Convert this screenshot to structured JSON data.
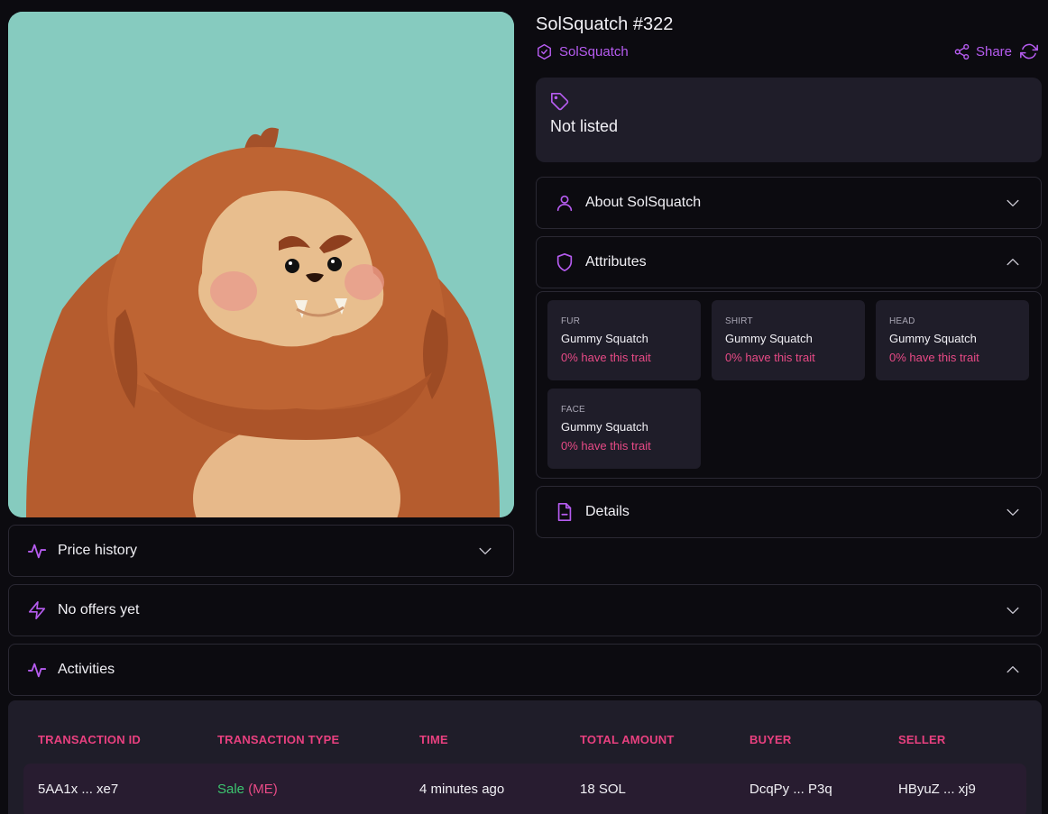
{
  "nft": {
    "title": "SolSquatch #322",
    "collection": "SolSquatch",
    "share_label": "Share",
    "listing_status": "Not listed"
  },
  "sections": {
    "about": "About SolSquatch",
    "attributes": "Attributes",
    "details": "Details",
    "price_history": "Price history",
    "offers": "No offers yet",
    "activities": "Activities"
  },
  "attributes": [
    {
      "type": "FUR",
      "value": "Gummy Squatch",
      "rarity": "0% have this trait"
    },
    {
      "type": "SHIRT",
      "value": "Gummy Squatch",
      "rarity": "0% have this trait"
    },
    {
      "type": "HEAD",
      "value": "Gummy Squatch",
      "rarity": "0% have this trait"
    },
    {
      "type": "FACE",
      "value": "Gummy Squatch",
      "rarity": "0% have this trait"
    }
  ],
  "activities": {
    "columns": [
      "TRANSACTION ID",
      "TRANSACTION TYPE",
      "TIME",
      "TOTAL AMOUNT",
      "BUYER",
      "SELLER"
    ],
    "rows": [
      {
        "tx_id": "5AA1x ... xe7",
        "type": "Sale",
        "marketplace": "(ME)",
        "time": "4 minutes ago",
        "amount": "18 SOL",
        "buyer": "DcqPy ... P3q",
        "seller": "HByuZ ... xj9"
      }
    ]
  },
  "colors": {
    "accent": "#b65cf0",
    "pink": "#e8407f",
    "sale_green": "#3cc46f",
    "card_bg": "#1f1d29",
    "page_bg": "#0c0b10",
    "image_bg": "#86cbbf"
  },
  "icons": {
    "collection": "verified-shield-icon",
    "share": "share-icon",
    "refresh": "refresh-icon",
    "listing": "tag-icon",
    "about": "user-icon",
    "attributes": "shield-icon",
    "details": "document-icon",
    "price_history": "activity-pulse-icon",
    "offers": "lightning-icon",
    "activities": "activity-pulse-icon",
    "collapse": "chevron-down-icon",
    "expand": "chevron-up-icon"
  }
}
